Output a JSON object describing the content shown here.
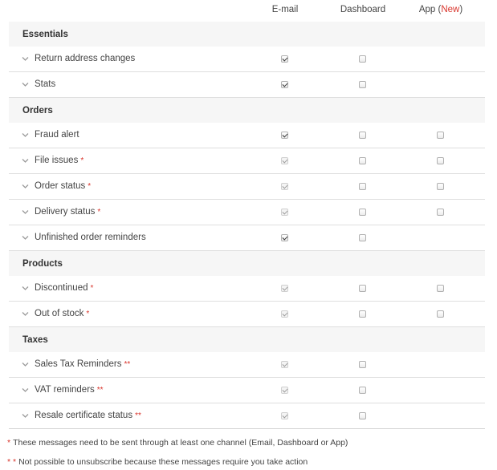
{
  "columns": {
    "email": "E-mail",
    "dashboard": "Dashboard",
    "app": "App (",
    "app_new": "New",
    "app_close": ")"
  },
  "sections": [
    {
      "title": "Essentials",
      "rows": [
        {
          "label": "Return address changes",
          "mark": "",
          "email": "checked",
          "dashboard": "unchecked",
          "app": "none"
        },
        {
          "label": "Stats",
          "mark": "",
          "email": "checked",
          "dashboard": "unchecked",
          "app": "none"
        }
      ]
    },
    {
      "title": "Orders",
      "rows": [
        {
          "label": "Fraud alert",
          "mark": "",
          "email": "checked",
          "dashboard": "unchecked",
          "app": "unchecked"
        },
        {
          "label": "File issues",
          "mark": "*",
          "email": "disabled-checked",
          "dashboard": "unchecked",
          "app": "unchecked"
        },
        {
          "label": "Order status",
          "mark": "*",
          "email": "disabled-checked",
          "dashboard": "unchecked",
          "app": "unchecked"
        },
        {
          "label": "Delivery status",
          "mark": "*",
          "email": "disabled-checked",
          "dashboard": "unchecked",
          "app": "unchecked"
        },
        {
          "label": "Unfinished order reminders",
          "mark": "",
          "email": "checked",
          "dashboard": "unchecked",
          "app": "none"
        }
      ]
    },
    {
      "title": "Products",
      "rows": [
        {
          "label": "Discontinued",
          "mark": "*",
          "email": "disabled-checked",
          "dashboard": "unchecked",
          "app": "unchecked"
        },
        {
          "label": "Out of stock",
          "mark": "*",
          "email": "disabled-checked",
          "dashboard": "unchecked",
          "app": "unchecked"
        }
      ]
    },
    {
      "title": "Taxes",
      "rows": [
        {
          "label": "Sales Tax Reminders",
          "mark": "**",
          "email": "disabled-checked",
          "dashboard": "unchecked",
          "app": "none"
        },
        {
          "label": "VAT reminders",
          "mark": "**",
          "email": "disabled-checked",
          "dashboard": "unchecked",
          "app": "none"
        },
        {
          "label": "Resale certificate status",
          "mark": "**",
          "email": "disabled-checked",
          "dashboard": "unchecked",
          "app": "none"
        }
      ]
    }
  ],
  "footnotes": [
    {
      "mark": "*",
      "text": "These messages need to be sent through at least one channel (Email, Dashboard or App)"
    },
    {
      "mark": "* *",
      "text": "Not possible to unsubscribe because these messages require you take action"
    }
  ],
  "colors": {
    "accent_red": "#d9342b",
    "section_bg": "#f6f6f6",
    "divider": "#dedede"
  },
  "icons": {
    "row_toggle": "chevron-down-icon"
  }
}
